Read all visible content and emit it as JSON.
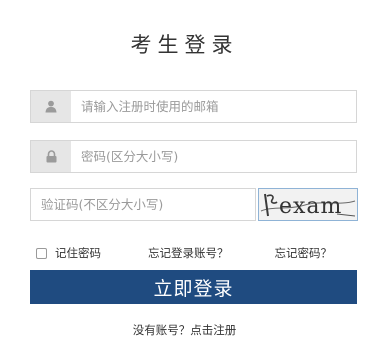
{
  "title": "考生登录",
  "email_field": {
    "placeholder": "请输入注册时使用的邮箱",
    "icon": "user-icon"
  },
  "password_field": {
    "placeholder": "密码(区分大小写)",
    "icon": "lock-icon"
  },
  "captcha": {
    "placeholder": "验证码(不区分大小写)",
    "image_text": "exam"
  },
  "options": {
    "remember_label": "记住密码",
    "forgot_account_label": "忘记登录账号？",
    "forgot_password_label": "忘记密码？"
  },
  "login_button_label": "立即登录",
  "register_link_label": "没有账号？点击注册",
  "colors": {
    "primary": "#1f4b80",
    "icon_bg": "#e6e6e6",
    "border": "#d6d6d6"
  }
}
